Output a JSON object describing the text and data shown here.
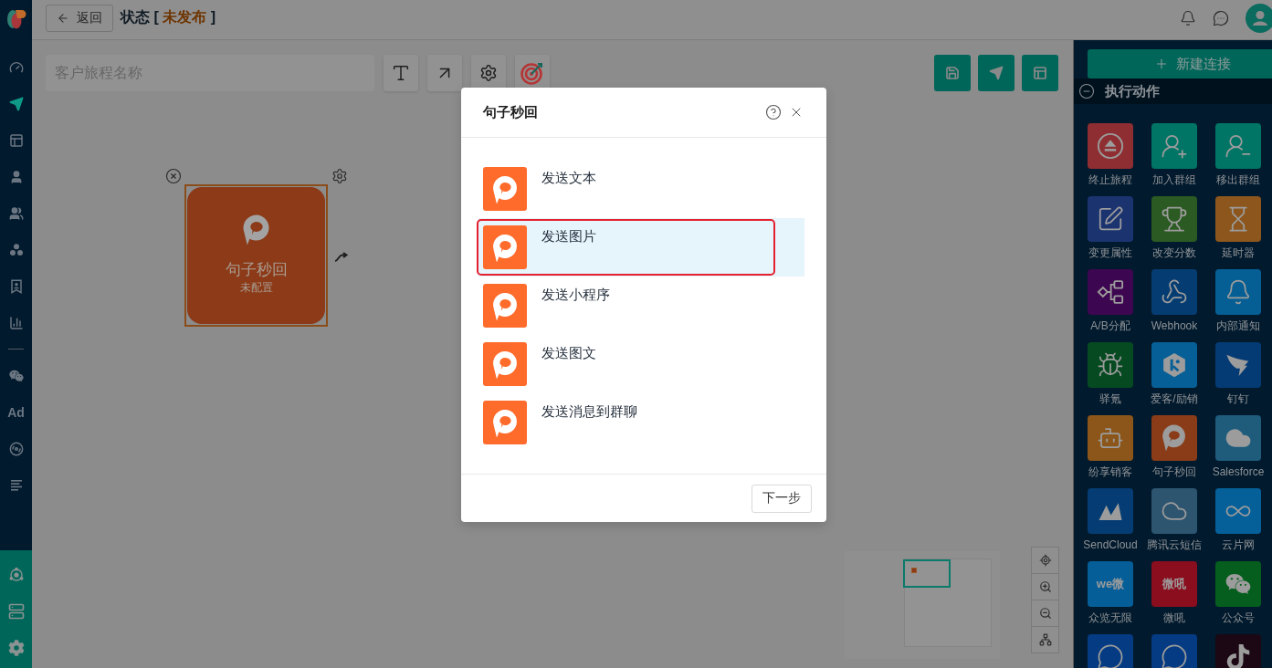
{
  "header": {
    "back_button": "返回",
    "title": "状态 [",
    "status": "未发布",
    "title_end": "]"
  },
  "sidebar": {
    "top_items": [
      {
        "selected": false
      },
      {
        "selected": true
      },
      {
        "selected": false
      },
      {
        "selected": false
      },
      {
        "selected": false
      },
      {
        "selected": false
      },
      {
        "selected": false
      },
      {
        "selected": false
      }
    ],
    "lower_items": [
      {
        "kind": "icon",
        "selected": false
      },
      {
        "kind": "text",
        "label": "Ad",
        "selected": false
      },
      {
        "kind": "icon",
        "selected": false
      },
      {
        "kind": "icon",
        "selected": false
      }
    ],
    "footer_items": [
      {
        "selected": false
      },
      {
        "selected": false
      },
      {
        "selected": false
      }
    ]
  },
  "toolbar": {
    "journey_name": {
      "placeholder": "客户旅程名称"
    }
  },
  "canvas": {
    "node": {
      "title": "句子秒回",
      "status": "未配置",
      "selected": true
    }
  },
  "actions_panel": {
    "new_connection_button": "新建连接",
    "section": {
      "title": "执行动作",
      "expanded": true
    },
    "items": [
      {
        "label": "终止旅程",
        "color": "#8f2e32"
      },
      {
        "label": "加入群组",
        "color": "#007565"
      },
      {
        "label": "移出群组",
        "color": "#007565"
      },
      {
        "label": "变更属性",
        "color": "#1b3470"
      },
      {
        "label": "改变分数",
        "color": "#2b5a22"
      },
      {
        "label": "延时器",
        "color": "#8c561c"
      },
      {
        "label": "A/B分配",
        "color": "#3d0650"
      },
      {
        "label": "Webhook",
        "color": "#053d73"
      },
      {
        "label": "内部通知",
        "color": "#055e94"
      },
      {
        "label": "驿氪",
        "color": "#064a22"
      },
      {
        "label": "爱客/励销",
        "color": "#065f96"
      },
      {
        "label": "钉钉",
        "color": "#053b74"
      },
      {
        "label": "纷享销客",
        "color": "#8c561a"
      },
      {
        "label": "句子秒回",
        "color": "#8a3c18"
      },
      {
        "label": "Salesforce",
        "color": "#1f5c7c"
      },
      {
        "label": "SendCloud",
        "color": "#053c73"
      },
      {
        "label": "腾讯云短信",
        "color": "#2d5570"
      },
      {
        "label": "云片网",
        "color": "#05609a"
      },
      {
        "label": "众览无限",
        "color": "#065e98",
        "logo_text": "we微"
      },
      {
        "label": "微吼",
        "color": "#8a0e1e",
        "logo_text": "微吼"
      },
      {
        "label": "公众号",
        "color": "#055e1e"
      },
      {
        "color": "#053b82"
      },
      {
        "color": "#053b82"
      },
      {
        "color": "#1c0814"
      }
    ]
  },
  "dialog": {
    "title": "句子秒回",
    "options": [
      {
        "label": "发送文本",
        "selected": false,
        "highlighted": false
      },
      {
        "label": "发送图片",
        "selected": true,
        "highlighted": true
      },
      {
        "label": "发送小程序",
        "selected": false,
        "highlighted": false
      },
      {
        "label": "发送图文",
        "selected": false,
        "highlighted": false
      },
      {
        "label": "发送消息到群聊",
        "selected": false,
        "highlighted": false
      }
    ],
    "next_button": "下一步"
  }
}
